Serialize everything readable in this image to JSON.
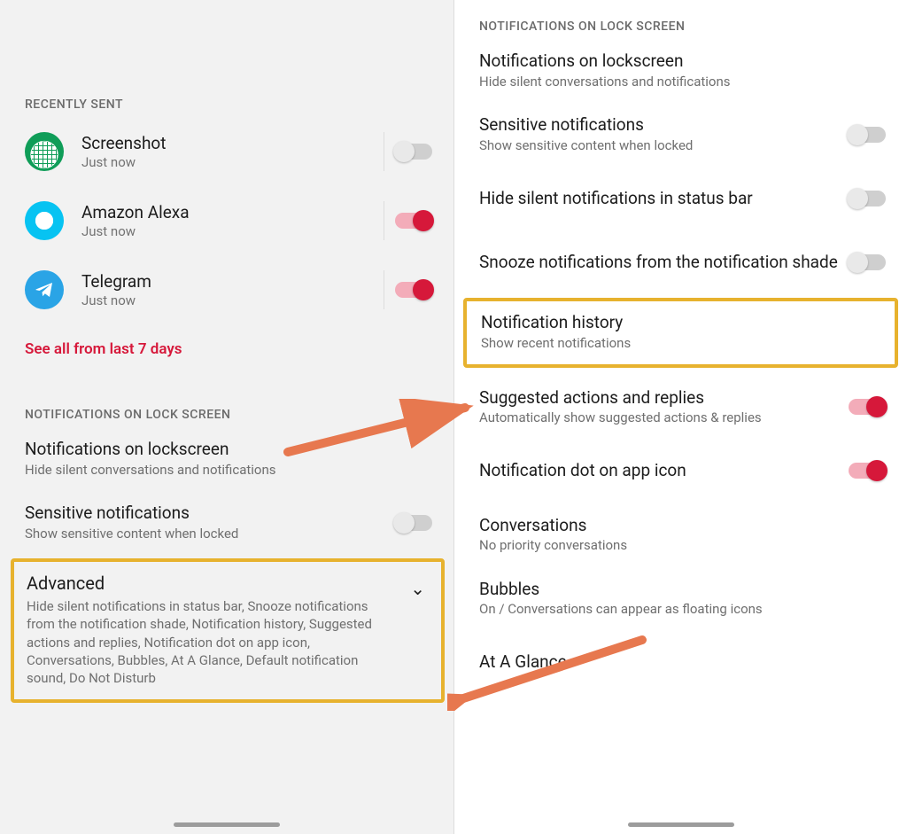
{
  "left": {
    "recently_sent_header": "RECENTLY SENT",
    "apps": [
      {
        "name": "Screenshot",
        "sub": "Just now",
        "toggle": "off"
      },
      {
        "name": "Amazon Alexa",
        "sub": "Just now",
        "toggle": "on"
      },
      {
        "name": "Telegram",
        "sub": "Just now",
        "toggle": "on"
      }
    ],
    "see_all": "See all from last 7 days",
    "lock_header": "NOTIFICATIONS ON LOCK SCREEN",
    "lockscreen": {
      "title": "Notifications on lockscreen",
      "sub": "Hide silent conversations and notifications"
    },
    "sensitive": {
      "title": "Sensitive notifications",
      "sub": "Show sensitive content when locked"
    },
    "advanced": {
      "title": "Advanced",
      "sub": "Hide silent notifications in status bar, Snooze notifications from the notification shade, Notification history, Suggested actions and replies, Notification dot on app icon, Conversations, Bubbles, At A Glance, Default notification sound, Do Not Disturb"
    }
  },
  "right": {
    "lock_header": "NOTIFICATIONS ON LOCK SCREEN",
    "lockscreen": {
      "title": "Notifications on lockscreen",
      "sub": "Hide silent conversations and notifications"
    },
    "sensitive": {
      "title": "Sensitive notifications",
      "sub": "Show sensitive content when locked"
    },
    "hide_silent": {
      "title": "Hide silent notifications in status bar"
    },
    "snooze": {
      "title": "Snooze notifications from the notification shade"
    },
    "history": {
      "title": "Notification history",
      "sub": "Show recent notifications"
    },
    "suggested": {
      "title": "Suggested actions and replies",
      "sub": "Automatically show suggested actions & replies"
    },
    "dot": {
      "title": "Notification dot on app icon"
    },
    "convos": {
      "title": "Conversations",
      "sub": "No priority conversations"
    },
    "bubbles": {
      "title": "Bubbles",
      "sub": "On / Conversations can appear as floating icons"
    },
    "glance": {
      "title": "At A Glance"
    }
  }
}
